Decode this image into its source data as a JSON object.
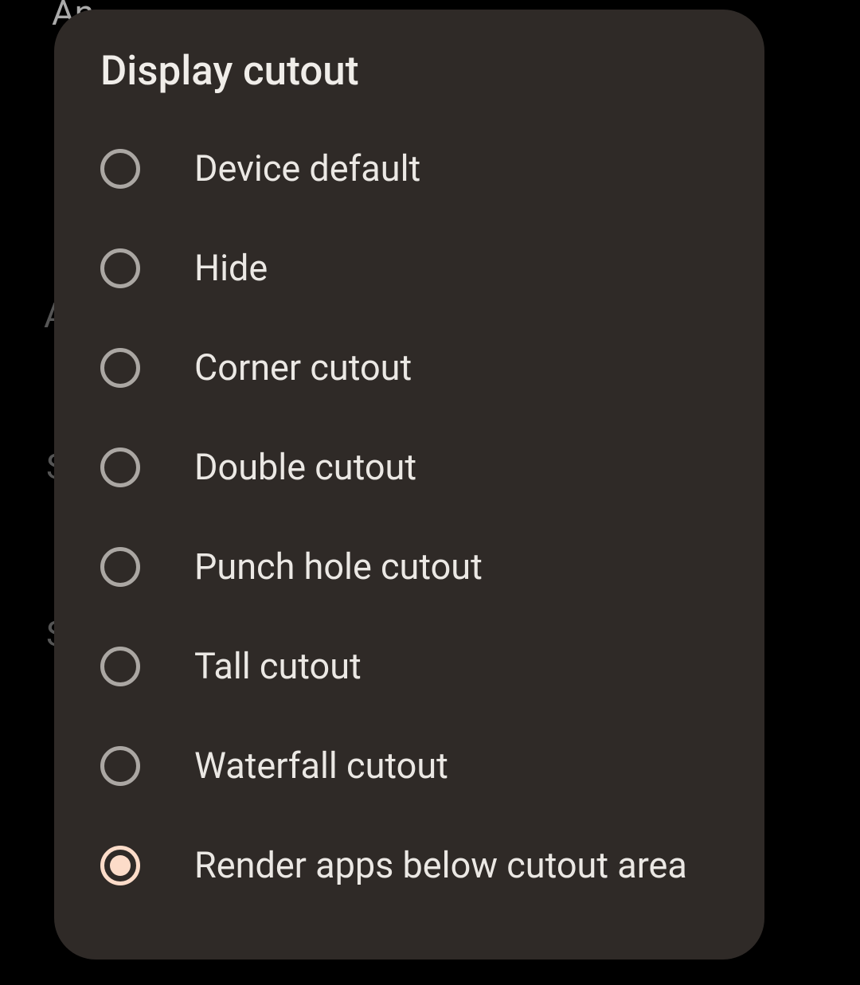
{
  "background": {
    "text1": "An",
    "text2": "A",
    "text3": "S",
    "text4": "S"
  },
  "dialog": {
    "title": "Display cutout",
    "options": [
      {
        "label": "Device default",
        "selected": false
      },
      {
        "label": "Hide",
        "selected": false
      },
      {
        "label": "Corner cutout",
        "selected": false
      },
      {
        "label": "Double cutout",
        "selected": false
      },
      {
        "label": "Punch hole cutout",
        "selected": false
      },
      {
        "label": "Tall cutout",
        "selected": false
      },
      {
        "label": "Waterfall cutout",
        "selected": false
      },
      {
        "label": "Render apps below cutout area",
        "selected": true
      }
    ]
  }
}
